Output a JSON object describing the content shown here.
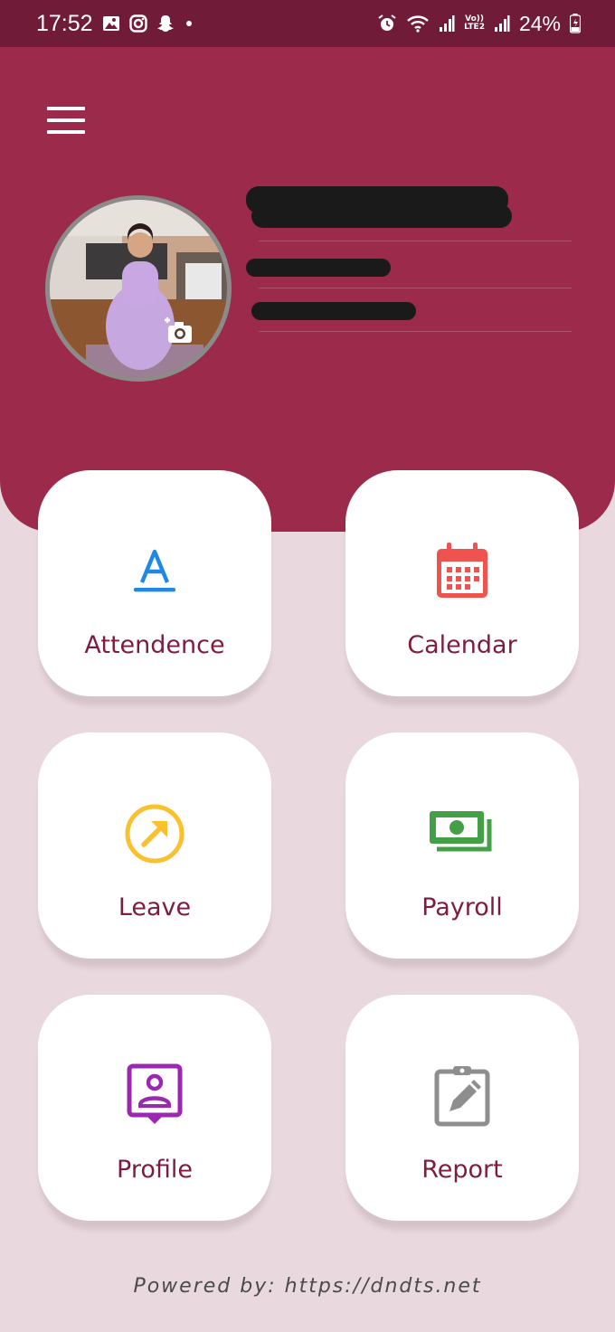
{
  "status_bar": {
    "time": "17:52",
    "battery": "24%",
    "network_label_top": "Vo))",
    "network_label_bottom": "LTE2",
    "icons": [
      "gallery-icon",
      "instagram-icon",
      "snapchat-icon",
      "dot-icon",
      "alarm-icon",
      "wifi-icon",
      "signal-icon",
      "signal-icon",
      "battery-charging-icon"
    ]
  },
  "header": {
    "menu_icon": "hamburger-menu-icon",
    "camera_icon": "add-photo-icon",
    "colors": {
      "header_bg": "#9b2a4b",
      "status_bg": "#701c38"
    }
  },
  "grid": [
    {
      "label": "Attendence",
      "icon": "attendance-a-icon",
      "color": "#1e88e5"
    },
    {
      "label": "Calendar",
      "icon": "calendar-icon",
      "color": "#ef5350"
    },
    {
      "label": "Leave",
      "icon": "leave-arrow-icon",
      "color": "#fbc02d"
    },
    {
      "label": "Payroll",
      "icon": "payroll-money-icon",
      "color": "#43a047"
    },
    {
      "label": "Profile",
      "icon": "profile-badge-icon",
      "color": "#9c27b0"
    },
    {
      "label": "Report",
      "icon": "report-clipboard-icon",
      "color": "#8e8e8e"
    }
  ],
  "footer": {
    "text": "Powered by: https://dndts.net"
  }
}
